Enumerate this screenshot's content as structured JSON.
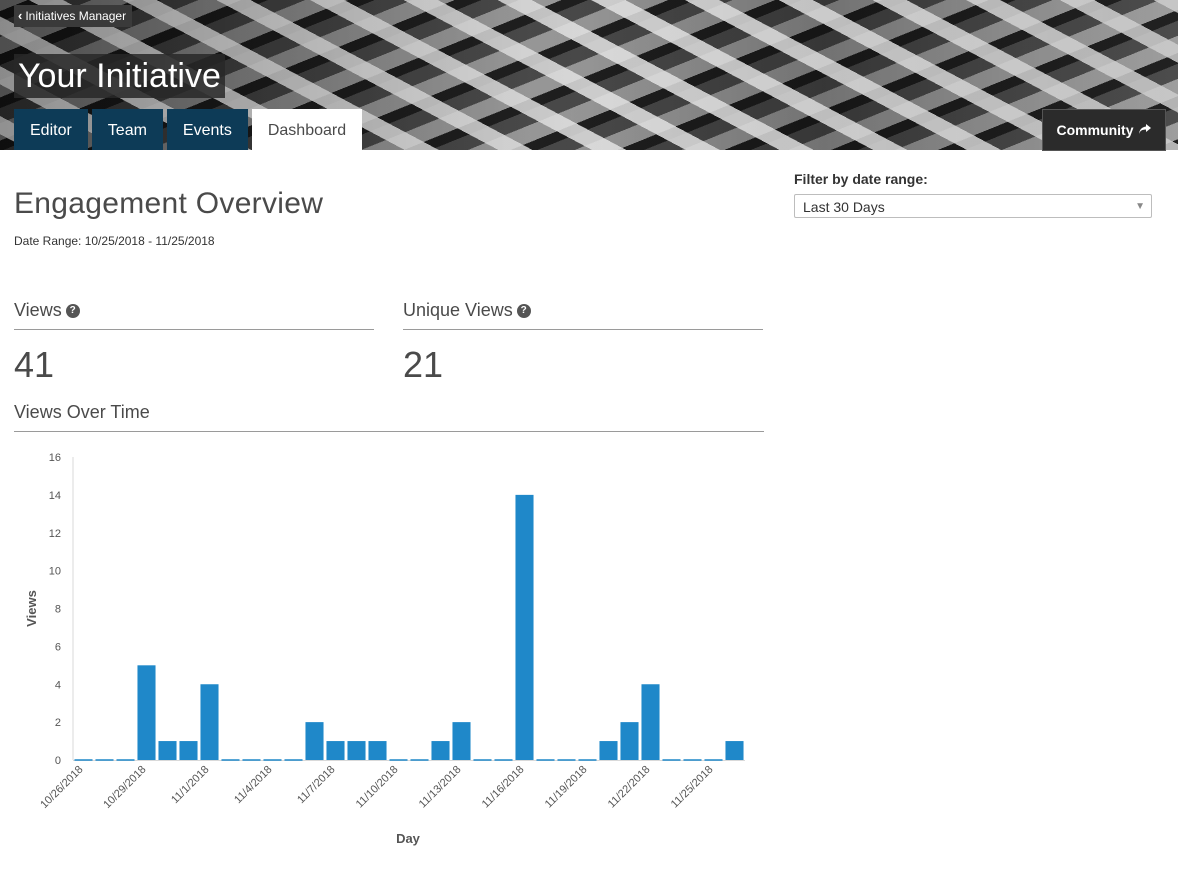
{
  "header": {
    "back_label": "Initiatives Manager",
    "title": "Your Initiative",
    "tabs": [
      {
        "label": "Editor",
        "active": false
      },
      {
        "label": "Team",
        "active": false
      },
      {
        "label": "Events",
        "active": false
      },
      {
        "label": "Dashboard",
        "active": true
      }
    ],
    "community_label": "Community"
  },
  "main": {
    "title": "Engagement Overview",
    "date_range": "Date Range: 10/25/2018 - 11/25/2018",
    "views_label": "Views",
    "views_value": "41",
    "unique_label": "Unique Views",
    "unique_value": "21",
    "chart_section_title": "Views Over Time"
  },
  "filter": {
    "label": "Filter by date range:",
    "selected": "Last 30 Days"
  },
  "colors": {
    "tab_bg": "#0d3b57",
    "bar": "#1f88c9"
  },
  "chart_data": {
    "type": "bar",
    "xlabel": "Day",
    "ylabel": "Views",
    "ylim": [
      0,
      16
    ],
    "yticks": [
      0,
      2,
      4,
      6,
      8,
      10,
      12,
      14,
      16
    ],
    "categories": [
      "10/26/2018",
      "10/27/2018",
      "10/28/2018",
      "10/29/2018",
      "10/30/2018",
      "10/31/2018",
      "11/1/2018",
      "11/2/2018",
      "11/3/2018",
      "11/4/2018",
      "11/5/2018",
      "11/6/2018",
      "11/7/2018",
      "11/8/2018",
      "11/9/2018",
      "11/10/2018",
      "11/11/2018",
      "11/12/2018",
      "11/13/2018",
      "11/14/2018",
      "11/15/2018",
      "11/16/2018",
      "11/17/2018",
      "11/18/2018",
      "11/19/2018",
      "11/20/2018",
      "11/21/2018",
      "11/22/2018",
      "11/23/2018",
      "11/24/2018",
      "11/25/2018",
      "11/26/2018"
    ],
    "tick_labels_shown": [
      "10/26/2018",
      "10/29/2018",
      "11/1/2018",
      "11/4/2018",
      "11/7/2018",
      "11/10/2018",
      "11/13/2018",
      "11/16/2018",
      "11/19/2018",
      "11/22/2018",
      "11/25/2018"
    ],
    "values": [
      0,
      0,
      0,
      5,
      1,
      1,
      4,
      0,
      0,
      0,
      0,
      2,
      1,
      1,
      1,
      0,
      0,
      1,
      2,
      0,
      0,
      14,
      0,
      0,
      0,
      1,
      2,
      4,
      0,
      0,
      0,
      1
    ],
    "grid": false,
    "legend": "none"
  }
}
